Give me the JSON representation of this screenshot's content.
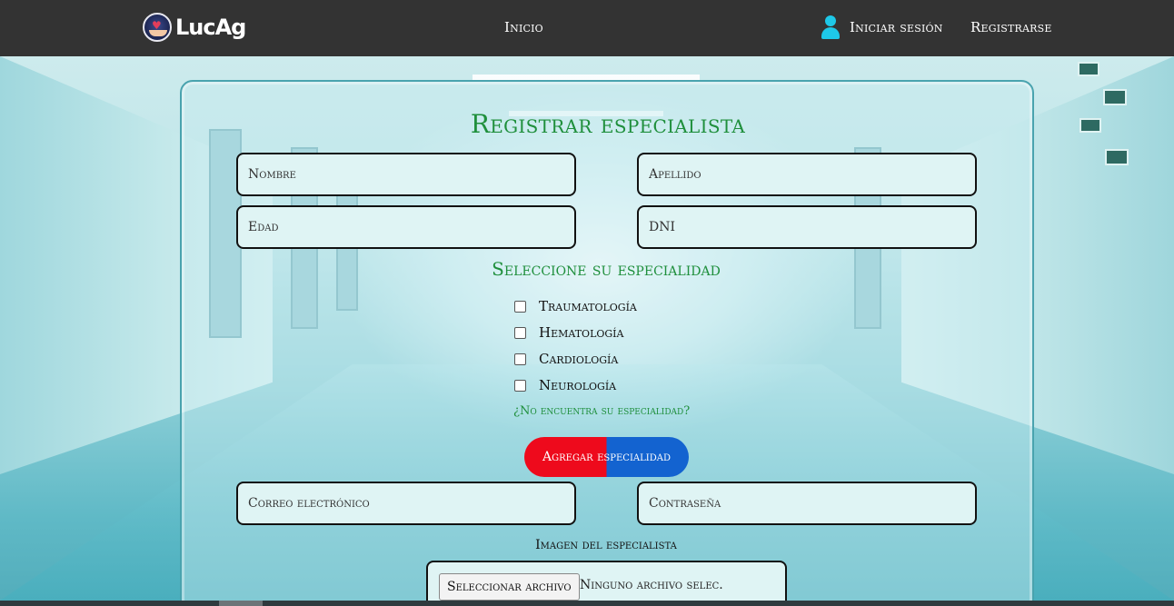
{
  "navbar": {
    "brand": "LucAg",
    "links": {
      "home": "Inicio",
      "login": "Iniciar sesión",
      "register": "Registrarse"
    }
  },
  "form": {
    "title": "Registrar especialista",
    "fields": {
      "first_name_placeholder": "Nombre",
      "last_name_placeholder": "Apellido",
      "age_placeholder": "Edad",
      "dni_placeholder": "DNI",
      "email_placeholder": "Correo electrónico",
      "password_placeholder": "Contraseña"
    },
    "specialty_title": "Seleccione su especialidad",
    "specialties": [
      {
        "label": "Traumatología",
        "checked": false
      },
      {
        "label": "Hematología",
        "checked": false
      },
      {
        "label": "Cardiología",
        "checked": false
      },
      {
        "label": "Neurología",
        "checked": false
      }
    ],
    "missing_specialty_text": "¿No encuentra su especialidad?",
    "add_specialty_button": "Agregar especialidad",
    "image_label": "Imagen del especialista",
    "file_button": "Seleccionar archivo",
    "file_status": "Ninguno archivo selec.",
    "colors": {
      "title_green": "#1f8f3c",
      "button_red": "#ee0a1c",
      "button_blue": "#1363d0"
    }
  }
}
